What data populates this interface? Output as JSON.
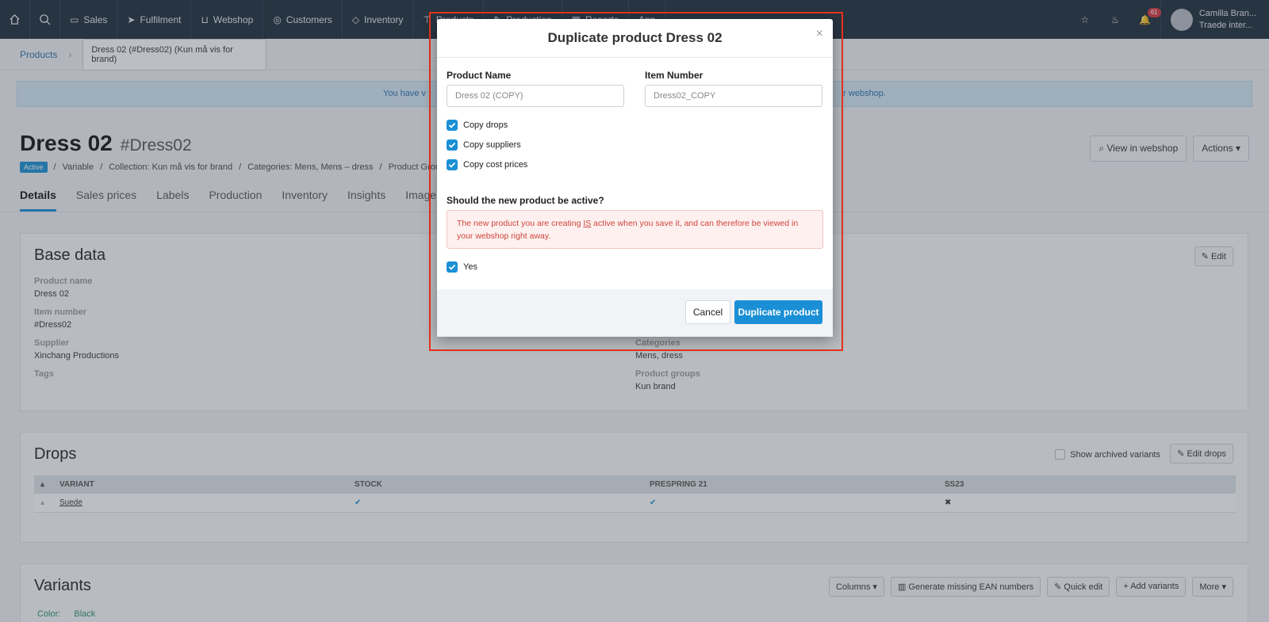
{
  "nav": {
    "items": [
      {
        "label": "Sales",
        "icon": "file-icon"
      },
      {
        "label": "Fulfilment",
        "icon": "send-icon"
      },
      {
        "label": "Webshop",
        "icon": "cart-icon"
      },
      {
        "label": "Customers",
        "icon": "users-icon"
      },
      {
        "label": "Inventory",
        "icon": "box-icon"
      },
      {
        "label": "Products",
        "icon": "shirt-icon"
      },
      {
        "label": "Production",
        "icon": "pen-icon"
      },
      {
        "label": "Reports",
        "icon": "chart-icon"
      },
      {
        "label": "App",
        "icon": "app-icon"
      }
    ],
    "notification_count": "61",
    "user_name": "Camilla Bran...",
    "user_company": "Traede inter..."
  },
  "breadcrumb": {
    "root": "Products",
    "current": "Dress 02 (#Dress02) (Kun må vis for brand)"
  },
  "info_bar": {
    "left_text": "You have v",
    "right_text": "r webshop."
  },
  "product": {
    "name": "Dress 02",
    "sku": "#Dress02",
    "status": "Active",
    "meta": [
      "Variable",
      "Collection: Kun må vis for brand",
      "Categories: Mens, Mens – dress",
      "Product Group"
    ]
  },
  "header_buttons": {
    "view": "View in webshop",
    "actions": "Actions"
  },
  "tabs": [
    "Details",
    "Sales prices",
    "Labels",
    "Production",
    "Inventory",
    "Insights",
    "Images &"
  ],
  "base_data": {
    "title": "Base data",
    "edit": "Edit",
    "fields": [
      {
        "label": "Product name",
        "value": "Dress 02"
      },
      {
        "label": "Item number",
        "value": "#Dress02"
      },
      {
        "label": "Supplier",
        "value": "Xinchang Productions"
      },
      {
        "label": "Tags",
        "value": ""
      }
    ],
    "right_fields": [
      {
        "label": "Categories",
        "value": "Mens, dress"
      },
      {
        "label": "Product groups",
        "value": "Kun brand"
      }
    ]
  },
  "drops": {
    "title": "Drops",
    "show_archived": "Show archived variants",
    "edit": "Edit drops",
    "columns": [
      "VARIANT",
      "STOCK",
      "PRESPRING 21",
      "SS23"
    ],
    "row": {
      "variant": "Suede",
      "stock": "✔",
      "prespring": "✔",
      "ss23": "✖"
    }
  },
  "variants": {
    "title": "Variants",
    "buttons": {
      "columns": "Columns",
      "ean": "Generate missing EAN numbers",
      "quick_edit": "Quick edit",
      "add": "Add variants",
      "more": "More"
    },
    "color_label": "Color:",
    "color_value": "Black"
  },
  "modal": {
    "title": "Duplicate product Dress 02",
    "name_label": "Product Name",
    "name_placeholder": "Dress 02 (COPY)",
    "item_label": "Item Number",
    "item_placeholder": "Dress02_COPY",
    "checkboxes": [
      "Copy drops",
      "Copy suppliers",
      "Copy cost prices"
    ],
    "active_question": "Should the new product be active?",
    "warning_pre": "The new product you are creating ",
    "warning_is": "IS",
    "warning_post": " active when you save it, and can therefore be viewed in your webshop right away.",
    "yes_label": "Yes",
    "cancel": "Cancel",
    "duplicate": "Duplicate product"
  },
  "colors": {
    "accent": "#1a8fd6",
    "nav_bg": "#1c2b3a",
    "highlight": "#e8331c",
    "warning": "#d0453b"
  }
}
